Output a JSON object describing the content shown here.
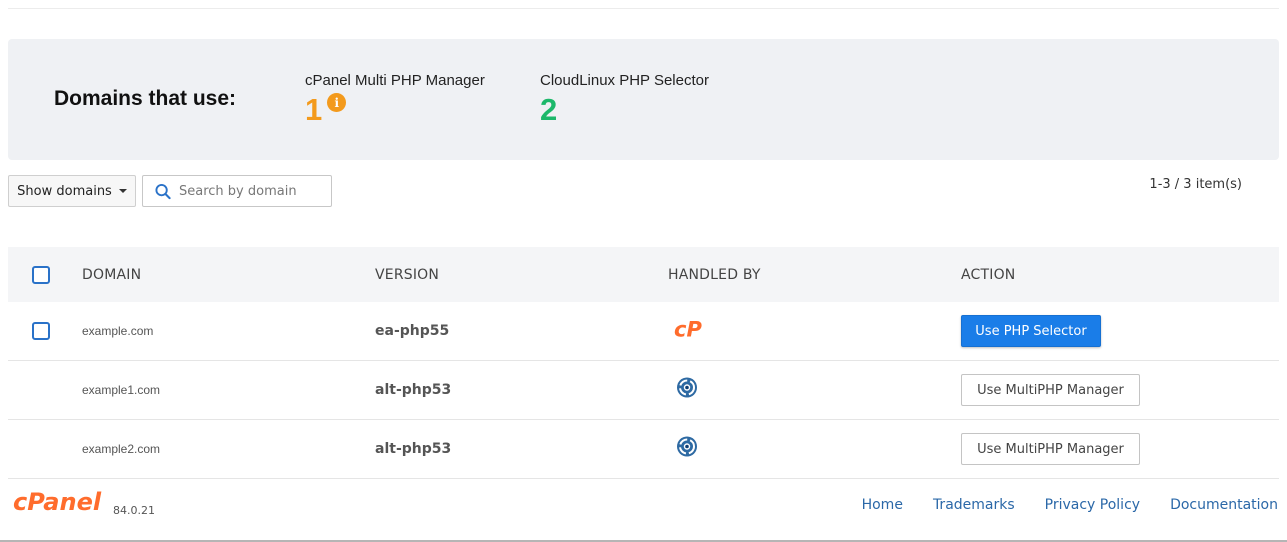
{
  "summary": {
    "title": "Domains that use:",
    "stats": [
      {
        "label": "cPanel Multi PHP Manager",
        "count": "1",
        "color": "#f39a1c",
        "icon": "info-icon"
      },
      {
        "label": "CloudLinux PHP Selector",
        "count": "2",
        "color": "#1cb86a"
      }
    ]
  },
  "toolbar": {
    "show_domains_label": "Show domains",
    "search_placeholder": "Search by domain",
    "pagination": "1-3 / 3 item(s)"
  },
  "table": {
    "columns": [
      "DOMAIN",
      "VERSION",
      "HANDLED BY",
      "ACTION"
    ],
    "rows": [
      {
        "domain": "example.com",
        "version": "ea-php55",
        "handler_icon": "cpanel-handler-icon",
        "action": "Use PHP Selector",
        "selectable": true
      },
      {
        "domain": "example1.com",
        "version": "alt-php53",
        "handler_icon": "cloudlinux-handler-icon",
        "action": "Use MultiPHP Manager",
        "selectable": false
      },
      {
        "domain": "example2.com",
        "version": "alt-php53",
        "handler_icon": "cloudlinux-handler-icon",
        "action": "Use MultiPHP Manager",
        "selectable": false
      }
    ]
  },
  "footer": {
    "logo_text": "cPanel",
    "version": "84.0.21",
    "links": [
      "Home",
      "Trademarks",
      "Privacy Policy",
      "Documentation"
    ]
  },
  "colors": {
    "accent": "#1a7de8",
    "brand_orange": "#ff6c2c",
    "link": "#2b68a8"
  }
}
